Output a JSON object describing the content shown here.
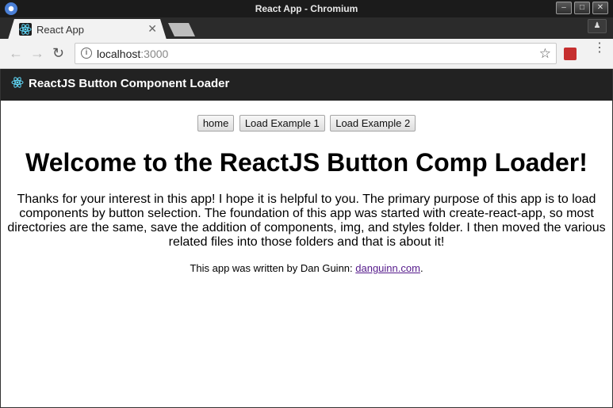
{
  "window": {
    "title": "React App - Chromium"
  },
  "tabs": [
    {
      "label": "React App",
      "favicon": "react-logo-icon",
      "active": true
    }
  ],
  "toolbar": {
    "url_host": "localhost",
    "url_port": ":3000"
  },
  "app": {
    "header_title": "ReactJS Button Component Loader",
    "nav_buttons": [
      "home",
      "Load Example 1",
      "Load Example 2"
    ],
    "heading": "Welcome to the ReactJS Button Comp Loader!",
    "intro": "Thanks for your interest in this app! I hope it is helpful to you. The primary purpose of this app is to load components by button selection. The foundation of this app was started with create-react-app, so most directories are the same, save the addition of components, img, and styles folder. I then moved the various related files into those folders and that is about it!",
    "credit_prefix": "This app was written by Dan Guinn: ",
    "credit_link": "danguinn.com",
    "credit_suffix": "."
  },
  "colors": {
    "header_bg": "#222222",
    "react_accent": "#61dafb",
    "link": "#551a8b"
  }
}
